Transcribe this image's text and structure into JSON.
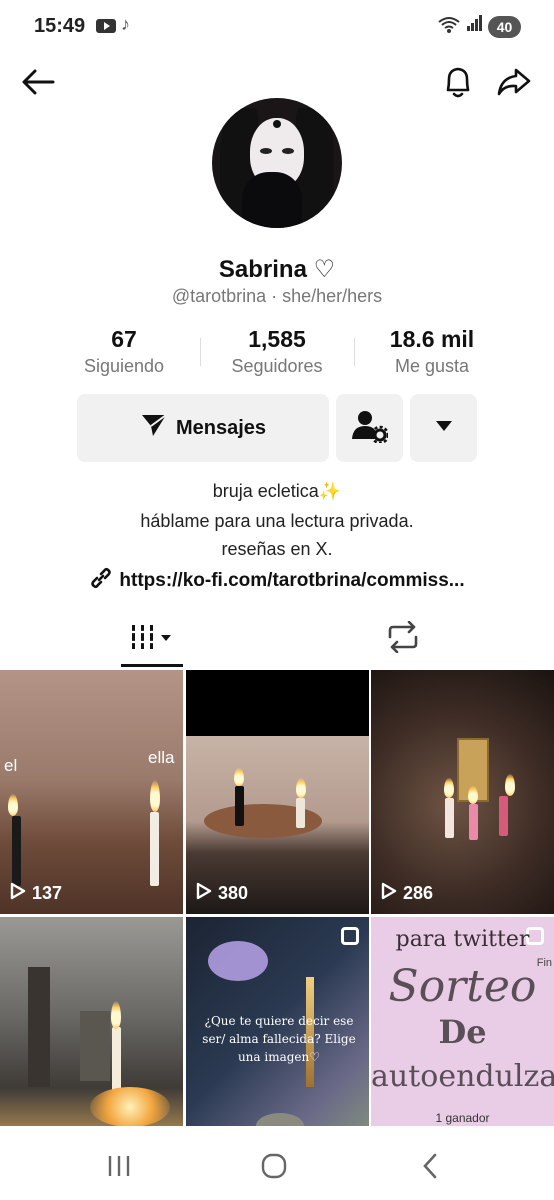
{
  "status_bar": {
    "time": "15:49",
    "battery": "40",
    "tiktok_glyph": "♪"
  },
  "profile": {
    "name": "Sabrina ♡",
    "handle": "@tarotbrina · she/her/hers",
    "stats": [
      {
        "value": "67",
        "label": "Siguiendo"
      },
      {
        "value": "1,585",
        "label": "Seguidores"
      },
      {
        "value": "18.6 mil",
        "label": "Me gusta"
      }
    ],
    "message_button": "Mensajes",
    "bio": [
      "bruja ecletica✨",
      "háblame para una lectura privada.",
      "reseñas en X."
    ],
    "link": "https://ko-fi.com/tarotbrina/commiss..."
  },
  "videos": [
    {
      "views": "137",
      "caption_left": "el",
      "caption_right": "ella"
    },
    {
      "views": "380"
    },
    {
      "views": "286"
    },
    {},
    {
      "caption": "¿Que te quiere decir ese ser/ alma fallecida? Elige una imagen♡"
    },
    {
      "top": "para twitter",
      "title1": "Sorteo",
      "title2": "De",
      "title3": "autoendulzamien",
      "corner": "Fin",
      "bottom": "1 ganador"
    }
  ]
}
